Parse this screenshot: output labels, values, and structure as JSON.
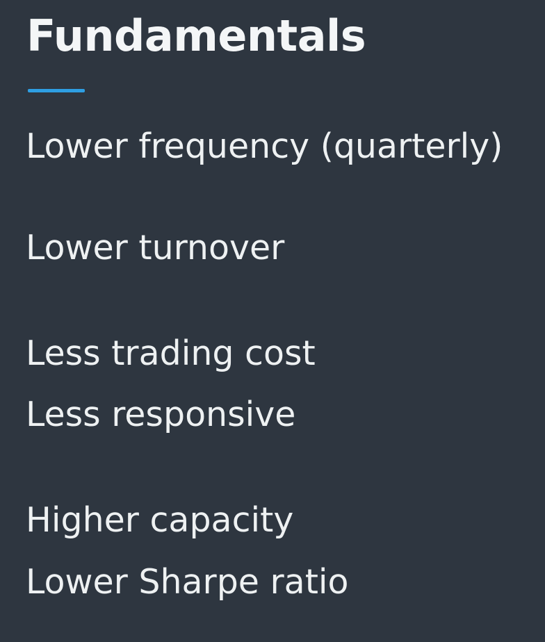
{
  "slide": {
    "title": "Fundamentals",
    "accent_color": "#2e9fe3",
    "background_color": "#2e3640",
    "lines": [
      "Lower frequency (quarterly)",
      "Lower turnover",
      "Less trading cost",
      "Less responsive",
      "Higher capacity",
      "Lower Sharpe ratio"
    ]
  }
}
